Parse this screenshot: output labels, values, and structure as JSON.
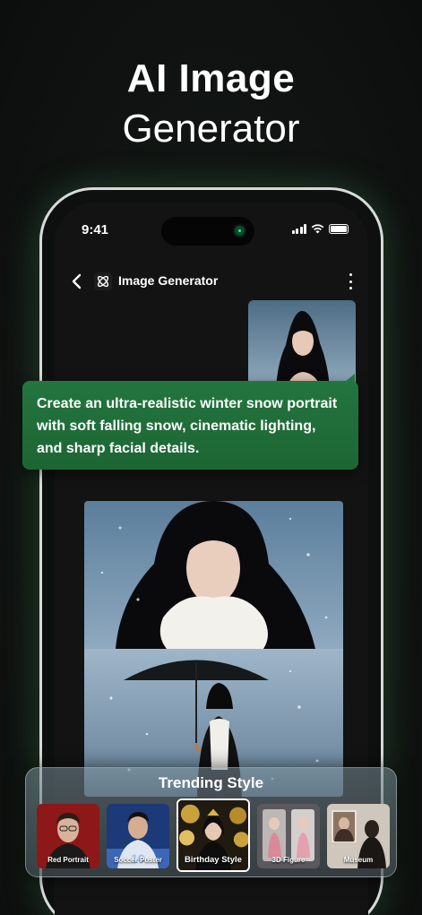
{
  "hero": {
    "line1": "AI Image",
    "line2": "Generator"
  },
  "status_bar": {
    "time": "9:41"
  },
  "header": {
    "title": "Image Generator"
  },
  "prompt": {
    "text": "Create an ultra-realistic winter snow portrait with soft falling snow, cinematic lighting, and sharp facial details."
  },
  "trending": {
    "title": "Trending Style",
    "styles": [
      {
        "label": "Red Portrait"
      },
      {
        "label": "Soccer Poster"
      },
      {
        "label": "Birthday Style",
        "selected": true
      },
      {
        "label": "3D Figure"
      },
      {
        "label": "Museum"
      }
    ]
  },
  "colors": {
    "accent_green": "#23753f",
    "background": "#111513"
  }
}
